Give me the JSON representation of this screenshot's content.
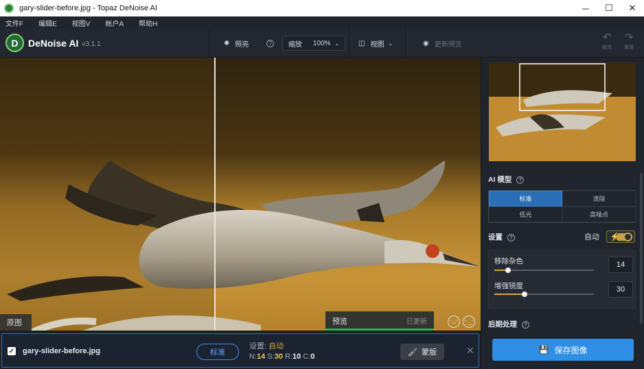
{
  "window": {
    "title": "gary-slider-before.jpg - Topaz DeNoise AI",
    "minimize": "─",
    "maximize": "☐",
    "close": "✕"
  },
  "menu": [
    {
      "label": "文件F"
    },
    {
      "label": "编辑E"
    },
    {
      "label": "视图V"
    },
    {
      "label": "帐户A"
    },
    {
      "label": "帮助H"
    }
  ],
  "toolbar": {
    "logo_letter": "D",
    "brand_name": "DeNoise AI",
    "version": "v3.1.1",
    "lighting_label": "照亮",
    "zoom_label": "缩放",
    "zoom_value": "100%",
    "view_label": "视图",
    "update_preview_label": "更新预览",
    "undo_label": "撤消",
    "redo_label": "重做"
  },
  "canvas": {
    "original_label": "原图",
    "preview_label": "预览",
    "preview_status": "已更新",
    "preview_progress": 1.0
  },
  "file": {
    "checked": true,
    "name": "gary-slider-before.jpg",
    "model_pill": "标准",
    "settings_prefix": "设置:",
    "settings_mode": "自动",
    "n_label": "N:",
    "n_value": "14",
    "s_label": "S:",
    "s_value": "30",
    "r_label": "R:",
    "r_value": "10",
    "c_label": "C:",
    "c_value": "0",
    "mask_label": "蒙版"
  },
  "panel": {
    "ai_model_title": "AI 模型",
    "models": [
      {
        "label": "标准",
        "active": true
      },
      {
        "label": "清除",
        "active": false
      },
      {
        "label": "低光",
        "active": false
      },
      {
        "label": "高噪点",
        "active": false
      }
    ],
    "settings_title": "设置",
    "auto_label": "自动",
    "auto_enabled": true,
    "remove_noise_label": "移除杂色",
    "remove_noise_value": "14",
    "remove_noise_level": 0.14,
    "enhance_sharpness_label": "增强锐度",
    "enhance_sharpness_value": "30",
    "enhance_sharpness_level": 0.3,
    "post_processing_title": "后期处理",
    "save_label": "保存图像"
  },
  "colors": {
    "accent_blue": "#2f8ee6",
    "active_model": "#2a6fb5",
    "progress_green": "#2cb44e",
    "slider_gold": "#d9a640"
  },
  "icons": {
    "lighting": "sun-icon",
    "help": "question-circle-icon",
    "view": "split-view-icon",
    "preview": "eye-icon",
    "undo": "undo-arrow-icon",
    "redo": "redo-arrow-icon",
    "mask": "brush-icon",
    "save": "floppy-disk-icon",
    "bolt": "lightning-bolt-icon"
  }
}
